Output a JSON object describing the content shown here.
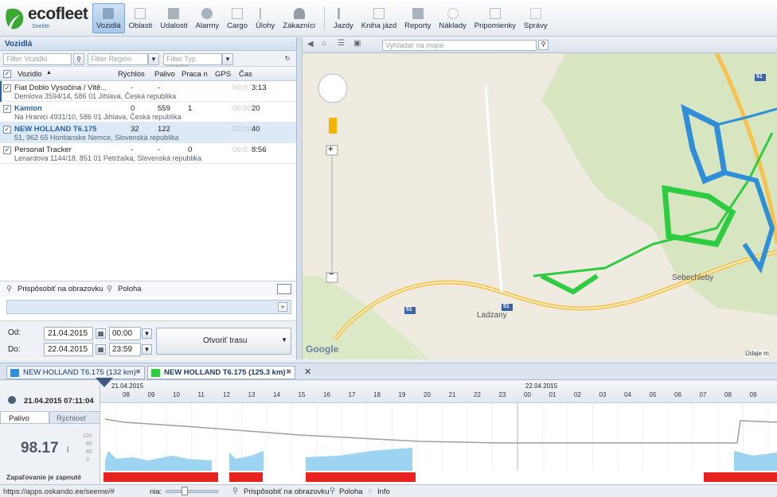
{
  "app": {
    "brand": "ecofleet",
    "sub": "SeeMe"
  },
  "nav": [
    "Vozidlá",
    "Oblasti",
    "Udalosti",
    "Alarmy",
    "Cargo",
    "Úlohy",
    "Zákazníci",
    "Jazdy",
    "Kniha jázd",
    "Reporty",
    "Náklady",
    "Pripomienky",
    "Správy"
  ],
  "vehicles_panel": {
    "title": "Vozidlá",
    "filter_vehicle": "Filter Vozidlo",
    "filter_region": "Filter Región",
    "filter_type": "Filter Typ vozidla",
    "columns": [
      "Vozidlo",
      "Rýchlos",
      "Palivo",
      "Praca n",
      "GPS",
      "Čas"
    ],
    "rows": [
      {
        "name": "Fiat Doblo Vysočina / Vitě...",
        "speed": "-",
        "fuel": "-",
        "work": "",
        "time_dim": "00:0",
        "time": "3:13",
        "address": "Demlova 3594/14, 586 01 Jihlava, Česká republika",
        "selected": false,
        "color": "#222"
      },
      {
        "name": "Kamion",
        "speed": "0",
        "fuel": "559",
        "work": "1",
        "time_dim": "00:00:",
        "time": "20",
        "address": "Na Hranici 4931/10, 586 01 Jihlava, Česká republika",
        "selected": false,
        "color": "#2563a8"
      },
      {
        "name": "NEW HOLLAND T6.175",
        "speed": "32",
        "fuel": "122",
        "work": "",
        "time_dim": "00:00:",
        "time": "40",
        "address": "51, 962 65 Hontianske Nemce, Slovenská republika",
        "selected": true,
        "color": "#2563a8"
      },
      {
        "name": "Personal Tracker",
        "speed": "-",
        "fuel": "-",
        "work": "0",
        "time_dim": "00:0",
        "time": "8:56",
        "address": "Lenardova 1144/18, 851 01 Petržalka, Slovenská republika",
        "selected": false,
        "color": "#222"
      }
    ],
    "fit_label": "Prispôsobiť na obrazovku",
    "position_label": "Poloha"
  },
  "date_panel": {
    "from_label": "Od:",
    "from_date": "21.04.2015",
    "from_time": "00:00",
    "to_label": "Do:",
    "to_date": "22.04.2015",
    "to_time": "23:59",
    "open_route": "Otvoriť trasu"
  },
  "map": {
    "search_placeholder": "Vyhľadať na mape",
    "place1": "Sebechleby",
    "place2": "Ladzany",
    "road": "51",
    "google": "Google",
    "data_note": "Údaje m"
  },
  "tabs": [
    {
      "label": "NEW HOLLAND T6.175",
      "dist": "(132 km)",
      "color": "#2e8fd8",
      "bold": false
    },
    {
      "label": "NEW HOLLAND T6.175",
      "dist": "(125.3 km)",
      "color": "#2ecc40",
      "bold": true
    }
  ],
  "timeline": {
    "datetime": "21.04.2015 07:11:04",
    "tab_fuel": "Palivo",
    "tab_speed": "Rýchlosť",
    "value": "98.17",
    "unit": "l",
    "ignition": "Zapaľovanie je zapnuté",
    "date1": "21.04.2015",
    "date2": "22.04.2015",
    "hours": [
      "08",
      "09",
      "10",
      "11",
      "12",
      "13",
      "14",
      "15",
      "16",
      "17",
      "18",
      "19",
      "20",
      "21",
      "22",
      "23",
      "00",
      "01",
      "02",
      "03",
      "04",
      "05",
      "06",
      "07",
      "08",
      "09"
    ],
    "yticks": [
      "120",
      "80",
      "40",
      "0"
    ]
  },
  "status": {
    "url": "https://apps.oskando.ee/seeme/#",
    "zoom_label": "nia:",
    "fit": "Prispôsobiť na obrazovku",
    "position": "Poloha",
    "info": "Info"
  },
  "colors": {
    "accent": "#2563a8",
    "green_route": "#2ecc40",
    "blue_route": "#2e8fd8",
    "ignition": "#e8231f",
    "fuel_fill": "#9dd4f2"
  }
}
